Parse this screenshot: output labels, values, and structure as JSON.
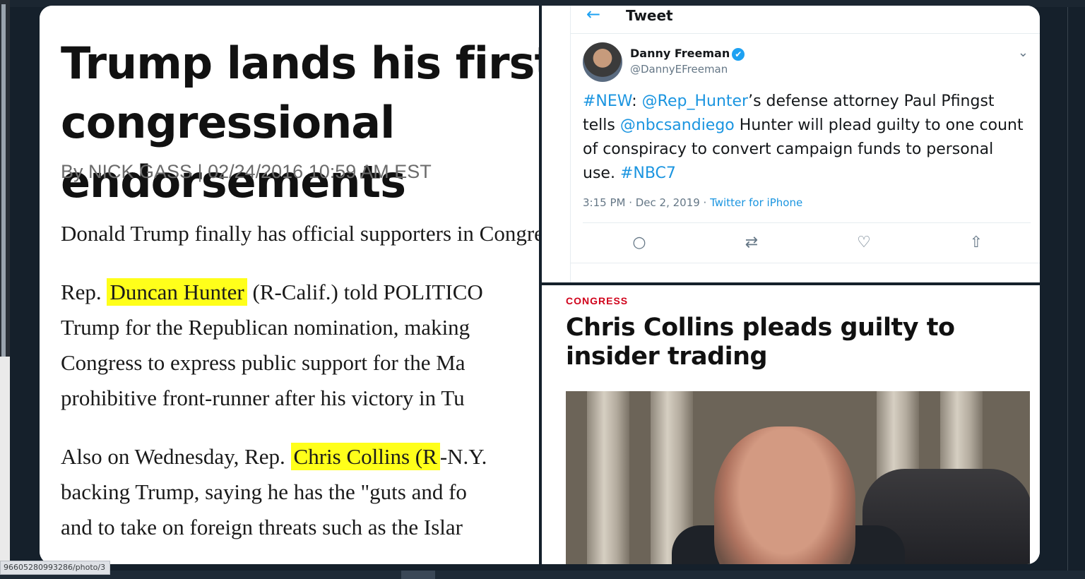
{
  "article": {
    "headline": "Trump lands his first congressional endorsements",
    "byline": "By NICK GASS | 02/24/2016 10:59 AM EST",
    "p1": "Donald Trump finally has official supporters in Congress.",
    "p2_prefix": "Rep. ",
    "p2_highlight": "Duncan Hunter",
    "p2_line1_rest": " (R-Calif.) told POLITICO",
    "p2_line2": "Trump for the Republican nomination, making",
    "p2_line3": "Congress to express public support for the Ma",
    "p2_line4": "prohibitive front-runner after his victory in Tu",
    "p3_prefix": "Also on Wednesday, Rep. ",
    "p3_highlight": "Chris Collins (R",
    "p3_line1_rest": "-N.Y.",
    "p3_line2": "backing Trump, saying he has the \"guts and fo",
    "p3_line3": "and to take on foreign threats such as the Islar"
  },
  "tweet": {
    "header_title": "Tweet",
    "back_icon": "←",
    "author_name": "Danny Freeman",
    "author_handle": "@DannyEFreeman",
    "verified_icon": "✔",
    "caret_icon": "⌄",
    "text_hashtag_new": "#NEW",
    "text_colon": ": ",
    "text_mention_hunter": "@Rep_Hunter",
    "text_part1": "’s defense attorney Paul Pfingst tells ",
    "text_mention_nbc": "@nbcsandiego",
    "text_part2": " Hunter will plead guilty to one count of conspiracy to convert campaign funds to personal use. ",
    "text_hashtag_nbc7": "#NBC7",
    "timestamp": "3:15 PM · Dec 2, 2019 · ",
    "source": "Twitter for iPhone",
    "actions": {
      "reply_icon": "○",
      "retweet_icon": "⇄",
      "like_icon": "♡",
      "share_icon": "⇧"
    }
  },
  "news": {
    "kicker": "CONGRESS",
    "title": "Chris Collins pleads guilty to insider trading"
  },
  "status_url": "96605280993286/photo/3"
}
